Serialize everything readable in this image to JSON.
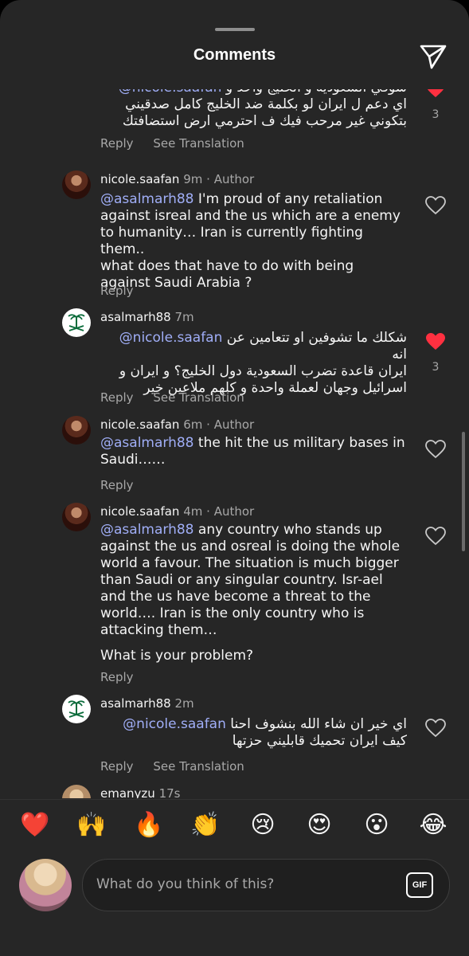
{
  "header": {
    "title": "Comments"
  },
  "comments": [
    {
      "username": "",
      "time": "",
      "author_badge": "",
      "lines": [
        {
          "mention": "@nicole.saafan",
          "text": "شوفي السعودية و الخليج واحد و"
        },
        {
          "mention": "",
          "text": "اي دعم ل ايران لو بكلمة ضد الخليج كامل صدقيني"
        },
        {
          "mention": "",
          "text": "بتكوني غير مرحب فيك ف احترمي ارض استضافتك"
        }
      ],
      "reply": "Reply",
      "see_translation": "See Translation",
      "liked": true,
      "like_count": "3"
    },
    {
      "username": "nicole.saafan",
      "time": "9m",
      "author_badge": "Author",
      "lines": [
        {
          "mention": "@asalmarh88",
          "text": " I'm proud of any retaliation"
        },
        {
          "mention": "",
          "text": "against isreal and the us which are a enemy"
        },
        {
          "mention": "",
          "text": "to humanity… Iran is currently fighting them.."
        },
        {
          "mention": "",
          "text": "what does that have to do with being"
        },
        {
          "mention": "",
          "text": "against Saudi Arabia ?"
        }
      ],
      "reply": "Reply",
      "see_translation": "",
      "liked": false,
      "like_count": ""
    },
    {
      "username": "asalmarh88",
      "time": "7m",
      "author_badge": "",
      "lines": [
        {
          "mention": "@nicole.saafan",
          "text": "شكلك ما تشوفين او تتعامين عن انه"
        },
        {
          "mention": "",
          "text": "ايران قاعدة تضرب السعودية دول الخليج؟ و ايران و"
        },
        {
          "mention": "",
          "text": "اسرائيل وجهان لعملة واحدة و كلهم ملاعين خير"
        }
      ],
      "reply": "Reply",
      "see_translation": "See Translation",
      "liked": true,
      "like_count": "3"
    },
    {
      "username": "nicole.saafan",
      "time": "6m",
      "author_badge": "Author",
      "lines": [
        {
          "mention": "@asalmarh88",
          "text": " the hit the us military bases in"
        },
        {
          "mention": "",
          "text": "Saudi……"
        }
      ],
      "reply": "Reply",
      "see_translation": "",
      "liked": false,
      "like_count": ""
    },
    {
      "username": "nicole.saafan",
      "time": "4m",
      "author_badge": "Author",
      "lines": [
        {
          "mention": "@asalmarh88",
          "text": " any country who stands up"
        },
        {
          "mention": "",
          "text": "against the us and osreal is doing the whole"
        },
        {
          "mention": "",
          "text": "world a favour. The situation is much bigger"
        },
        {
          "mention": "",
          "text": "than Saudi or any singular country. Isr-ael"
        },
        {
          "mention": "",
          "text": "and the us have become a threat to the"
        },
        {
          "mention": "",
          "text": "world…. Iran is the only country who is"
        },
        {
          "mention": "",
          "text": "attacking them…"
        },
        {
          "mention": "",
          "text": ""
        },
        {
          "mention": "",
          "text": "What is your problem?"
        }
      ],
      "reply": "Reply",
      "see_translation": "",
      "liked": false,
      "like_count": ""
    },
    {
      "username": "asalmarh88",
      "time": "2m",
      "author_badge": "",
      "lines": [
        {
          "mention": "@nicole.saafan",
          "text": "اي خير ان شاء الله بنشوف احنا"
        },
        {
          "mention": "",
          "text": "كيف ايران تحميك قابليني حزتها"
        }
      ],
      "reply": "Reply",
      "see_translation": "See Translation",
      "liked": false,
      "like_count": ""
    },
    {
      "username": "emanyzu",
      "time": "17s",
      "author_badge": "",
      "lines": [],
      "reply": "",
      "see_translation": "",
      "liked": false,
      "like_count": ""
    }
  ],
  "reactions": [
    "❤️",
    "🙌",
    "🔥",
    "👏",
    "😢",
    "😍",
    "😮",
    "😂"
  ],
  "composer": {
    "placeholder": "What do you think of this?",
    "gif_label": "GIF"
  },
  "colors": {
    "background": "#262626",
    "mention": "#a0aef7",
    "like": "#ff3040",
    "muted": "#a8a8a8"
  }
}
